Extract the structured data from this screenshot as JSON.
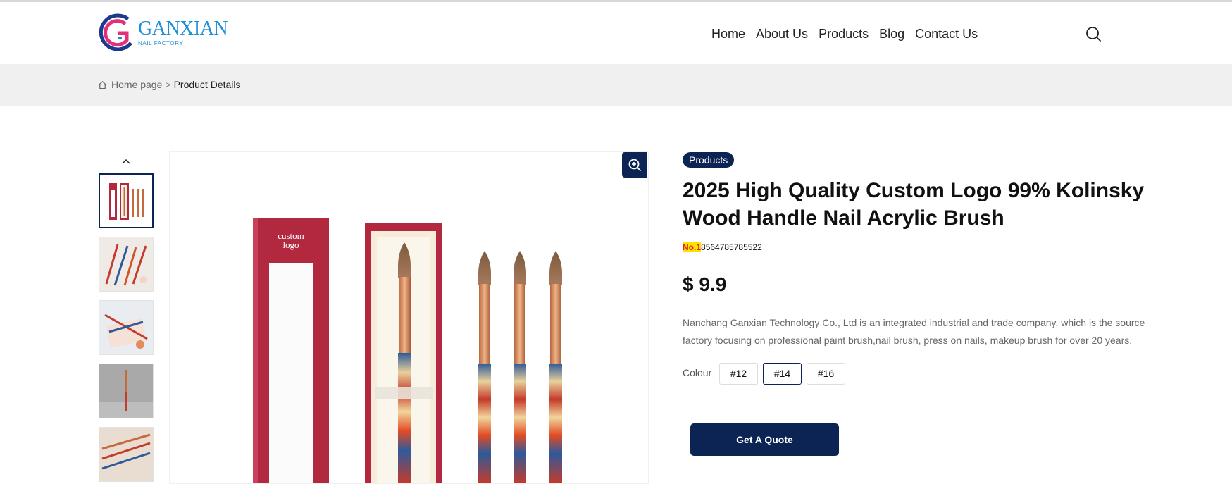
{
  "header": {
    "logo_text": "GANXIAN",
    "logo_subtext": "NAIL FACTORY",
    "nav": [
      "Home",
      "About Us",
      "Products",
      "Blog",
      "Contact Us"
    ],
    "search_icon": "search-icon"
  },
  "breadcrumb": {
    "home": "Home page",
    "separator": ">",
    "current": "Product Details"
  },
  "gallery": {
    "up_icon": "chevron-up-icon",
    "zoom_icon": "zoom-in-icon",
    "box_text_line1": "custom",
    "box_text_line2": "logo"
  },
  "product": {
    "category_badge": "Products",
    "title": "2025 High Quality Custom Logo 99% Kolinsky Wood Handle Nail Acrylic Brush",
    "sku_prefix": "No.1",
    "sku_rest": "8564785785522",
    "price": "$ 9.9",
    "description": "Nanchang Ganxian Technology Co., Ltd is an integrated industrial and trade company, which is the source factory focusing on professional paint brush,nail brush, press on nails, makeup brush for over 20 years.",
    "colour_label": "Colour",
    "colour_options": [
      "#12",
      "#14",
      "#16"
    ],
    "selected_colour": "#14",
    "quote_button": "Get A Quote"
  },
  "colors": {
    "brand_navy": "#0b2453",
    "logo_blue": "#1d8fd6",
    "logo_pink": "#e4307a",
    "box_red": "#b1283f",
    "sku_highlight": "#ffe100"
  }
}
